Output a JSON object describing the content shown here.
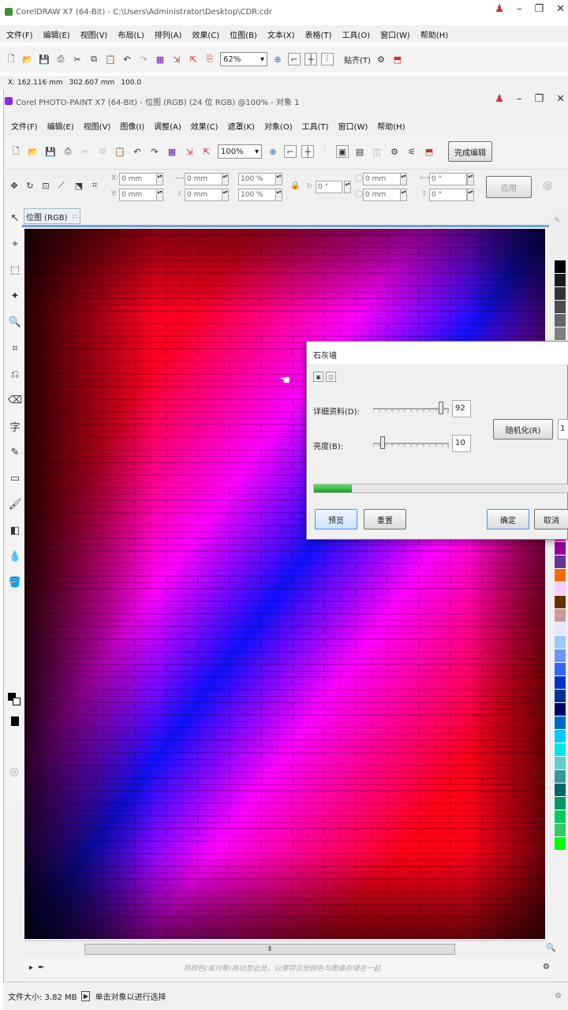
{
  "coreldraw": {
    "title": "CorelDRAW X7 (64-Bit) - C:\\Users\\Administrator\\Desktop\\CDR.cdr",
    "menu": [
      "文件(F)",
      "编辑(E)",
      "视图(V)",
      "布局(L)",
      "排列(A)",
      "效果(C)",
      "位图(B)",
      "文本(X)",
      "表格(T)",
      "工具(O)",
      "窗口(W)",
      "帮助(H)"
    ],
    "zoom": "62%",
    "snap_label": "贴齐(T)",
    "coord_x": "X: 162.116 mm",
    "coord_y": "302.607 mm",
    "size_val": "100.0"
  },
  "photopaint": {
    "title": "Corel PHOTO-PAINT X7 (64-Bit) - 位图 (RGB) (24 位 RGB) @100% - 对象 1",
    "menu": [
      "文件(F)",
      "编辑(E)",
      "视图(V)",
      "图像(I)",
      "调整(A)",
      "效果(C)",
      "遮罩(K)",
      "对象(O)",
      "工具(T)",
      "窗口(W)",
      "帮助(H)"
    ],
    "zoom": "100%",
    "finish_edit": "完成编辑",
    "apply": "应用",
    "props": {
      "x": "0 mm",
      "y": "0 mm",
      "w": "0 mm",
      "h": "0 mm",
      "sx": "100 %",
      "sy": "100 %",
      "rot": "0 °",
      "cx": "0 mm",
      "cy": "0 mm",
      "kx": "0 °",
      "ky": "0 °"
    },
    "doc_tab": "位图 (RGB)",
    "hint": "将颜色(或对象)拖动至此处，以便将这些颜色与图像存储在一起",
    "status_size": "文件大小: 3.82 MB",
    "status_msg": "单击对象以进行选择"
  },
  "dialog": {
    "title": "石灰墙",
    "detail_label": "详细资料(D):",
    "detail_value": "92",
    "detail_level": 0.92,
    "brightness_label": "亮度(B):",
    "brightness_value": "10",
    "brightness_level": 0.1,
    "randomize": "随机化(R)",
    "random_value": "1",
    "progress": 0.15,
    "preview": "预览",
    "reset": "重置",
    "ok": "确定",
    "cancel": "取消"
  },
  "colors": {
    "accent": "#3399ff",
    "progress_green": "#27b53a",
    "canvas_red": "#ff0018",
    "canvas_magenta": "#ff00ff",
    "canvas_blue": "#1010ff"
  },
  "palette": [
    "#000000",
    "#1a1a1a",
    "#333333",
    "#4d4d4d",
    "#666666",
    "#808080",
    "#999999",
    "#b3b3b3",
    "#cccccc",
    "#e6e6e6",
    "#ffffff",
    "#e0e0e0",
    "#a4e0f0",
    "#66ccff",
    "#ffff00",
    "#ffcc00",
    "#ff9900",
    "#ff6600",
    "#ff0000",
    "#cc0066",
    "#ff00cc",
    "#990099",
    "#663399",
    "#ff6600",
    "#ffccff",
    "#663300",
    "#cc9999",
    "#e6e6ff",
    "#99ccff",
    "#6699ff",
    "#3366ff",
    "#0033cc",
    "#003399",
    "#000066",
    "#0066cc",
    "#00ccff",
    "#00e6e6",
    "#66cccc",
    "#339999",
    "#006666",
    "#009966",
    "#00cc66",
    "#33cc66",
    "#00ff00"
  ]
}
